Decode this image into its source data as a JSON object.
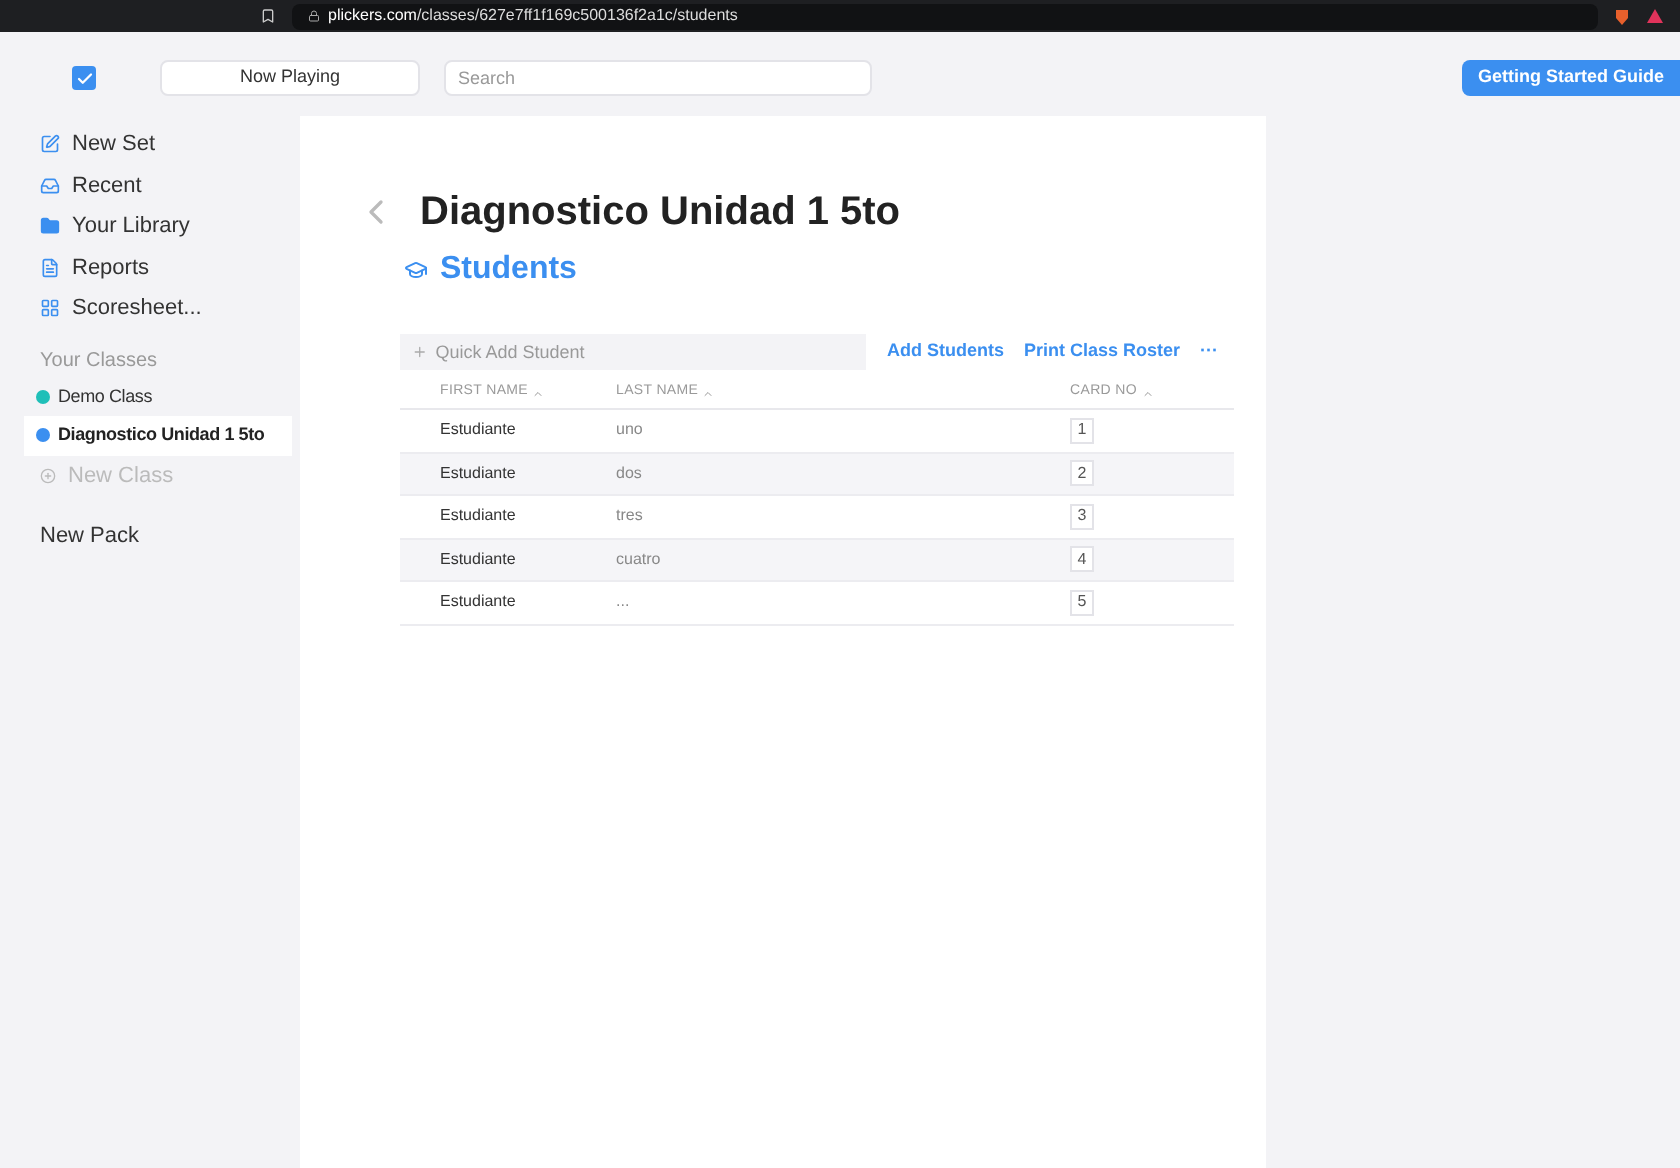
{
  "browser": {
    "url_host": "plickers.com",
    "url_path": "/classes/627e7ff1f169c500136f2a1c/students"
  },
  "toolbar": {
    "now_playing": "Now Playing",
    "search": {
      "placeholder": "Search"
    },
    "guide_button": "Getting Started Guide"
  },
  "sidebar": {
    "items": [
      {
        "kind": "link",
        "label": "New Set"
      },
      {
        "kind": "link",
        "label": "Recent"
      },
      {
        "kind": "link",
        "label": "Your Library"
      },
      {
        "kind": "link",
        "label": "Reports"
      },
      {
        "kind": "link",
        "label": "Scoresheet..."
      },
      {
        "kind": "heading",
        "label": "Your Classes"
      },
      {
        "kind": "class",
        "label": "Demo Class",
        "color": "#1fbfb8",
        "selected": false
      },
      {
        "kind": "class",
        "label": "Diagnostico Unidad 1 5to",
        "color": "#3b8ff0",
        "selected": true
      },
      {
        "kind": "new_class",
        "label": "New Class",
        "disabled": true
      },
      {
        "kind": "plain",
        "label": "New Pack"
      }
    ]
  },
  "page": {
    "title": "Diagnostico Unidad 1 5to",
    "subtitle": "Students"
  },
  "actions": {
    "quick_add": {
      "placeholder": "Quick Add Student"
    },
    "add_students": "Add Students",
    "print_roster": "Print Class Roster",
    "more": "···"
  },
  "table": {
    "columns": [
      "FIRST NAME",
      "LAST NAME",
      "CARD NO"
    ],
    "rows": [
      {
        "first": "Estudiante",
        "last": "uno",
        "card": "1"
      },
      {
        "first": "Estudiante",
        "last": "dos",
        "card": "2"
      },
      {
        "first": "Estudiante",
        "last": "tres",
        "card": "3"
      },
      {
        "first": "Estudiante",
        "last": "cuatro",
        "card": "4"
      },
      {
        "first": "Estudiante",
        "last": "...",
        "card": "5"
      }
    ]
  }
}
